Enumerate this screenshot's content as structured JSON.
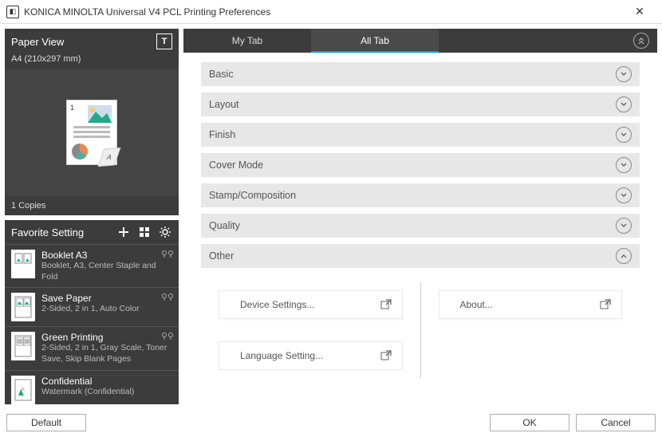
{
  "window": {
    "title": "KONICA MINOLTA Universal V4 PCL Printing Preferences"
  },
  "paper_view": {
    "title": "Paper View",
    "paper_size": "A4 (210x297 mm)",
    "copies": "1 Copies",
    "toggle_label": "T"
  },
  "favorites": {
    "title": "Favorite Setting",
    "items": [
      {
        "name": "Booklet A3",
        "desc": "Booklet, A3, Center Staple and Fold"
      },
      {
        "name": "Save Paper",
        "desc": "2-Sided, 2 in 1, Auto Color"
      },
      {
        "name": "Green Printing",
        "desc": "2-Sided, 2 in 1, Gray Scale, Toner Save, Skip Blank Pages"
      },
      {
        "name": "Confidential",
        "desc": "Watermark (Confidential)"
      }
    ]
  },
  "tabs": {
    "my": "My Tab",
    "all": "All Tab",
    "active": "all"
  },
  "sections": [
    {
      "key": "basic",
      "label": "Basic",
      "expanded": false
    },
    {
      "key": "layout",
      "label": "Layout",
      "expanded": false
    },
    {
      "key": "finish",
      "label": "Finish",
      "expanded": false
    },
    {
      "key": "cover",
      "label": "Cover Mode",
      "expanded": false
    },
    {
      "key": "stamp",
      "label": "Stamp/Composition",
      "expanded": false
    },
    {
      "key": "quality",
      "label": "Quality",
      "expanded": false
    },
    {
      "key": "other",
      "label": "Other",
      "expanded": true
    }
  ],
  "other": {
    "device_settings": "Device Settings...",
    "language_setting": "Language Setting...",
    "about": "About..."
  },
  "buttons": {
    "default": "Default",
    "ok": "OK",
    "cancel": "Cancel"
  },
  "colors": {
    "panel_dark": "#3c3c3c",
    "accent": "#0099e5",
    "section_bg": "#e7e7e7"
  }
}
